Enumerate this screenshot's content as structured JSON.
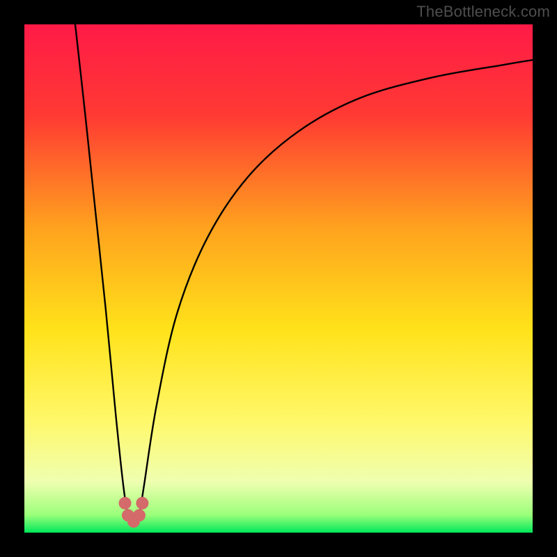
{
  "watermark": "TheBottleneck.com",
  "chart_data": {
    "type": "line",
    "title": "",
    "xlabel": "",
    "ylabel": "",
    "xlim": [
      0,
      100
    ],
    "ylim": [
      0,
      100
    ],
    "gradient_stops": [
      {
        "offset": 0.0,
        "color": "#ff1a47"
      },
      {
        "offset": 0.18,
        "color": "#ff3a33"
      },
      {
        "offset": 0.4,
        "color": "#ffa21e"
      },
      {
        "offset": 0.6,
        "color": "#ffe21a"
      },
      {
        "offset": 0.78,
        "color": "#fff86a"
      },
      {
        "offset": 0.9,
        "color": "#efffb0"
      },
      {
        "offset": 0.965,
        "color": "#9bff7a"
      },
      {
        "offset": 1.0,
        "color": "#00e85a"
      }
    ],
    "series": [
      {
        "name": "bottleneck-curve",
        "stroke": "#000000",
        "stroke_width": 2.4,
        "x": [
          10,
          12,
          14,
          16,
          18,
          19.5,
          20.5,
          21.5,
          22.5,
          23.5,
          26,
          30,
          36,
          44,
          54,
          66,
          80,
          94,
          100
        ],
        "y": [
          100,
          82,
          63,
          44,
          23,
          9,
          3,
          2,
          3,
          9,
          25,
          43,
          58,
          70,
          79,
          85.5,
          89.5,
          92,
          93
        ]
      }
    ],
    "markers": {
      "name": "min-region",
      "color": "#d46a6a",
      "radius": 9,
      "points": [
        {
          "x": 19.8,
          "y": 5.8
        },
        {
          "x": 20.4,
          "y": 3.4
        },
        {
          "x": 21.5,
          "y": 2.2
        },
        {
          "x": 22.6,
          "y": 3.4
        },
        {
          "x": 23.2,
          "y": 5.8
        }
      ]
    }
  }
}
